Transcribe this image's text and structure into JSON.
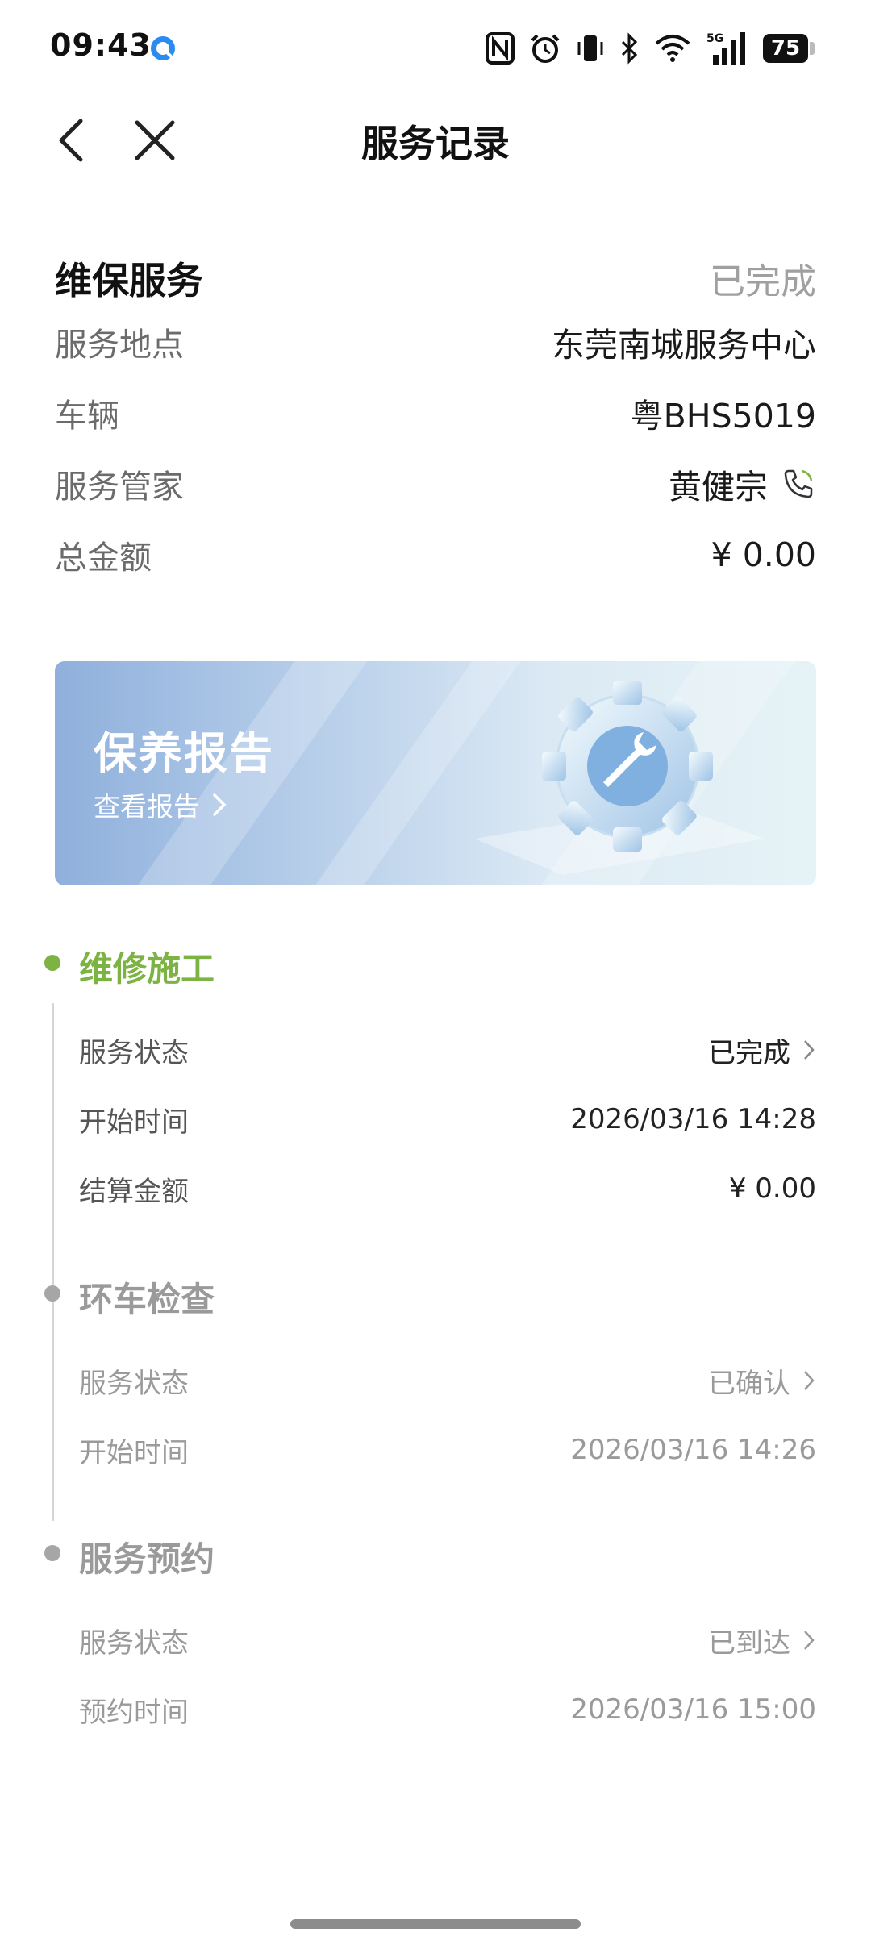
{
  "status_bar": {
    "time": "09:43",
    "icons": [
      "nfc-icon",
      "alarm-icon",
      "vibrate-icon",
      "bluetooth-icon",
      "wifi-icon",
      "signal-5g-icon"
    ],
    "network": "5G",
    "battery": "75"
  },
  "nav": {
    "title": "服务记录",
    "back_icon": "back-arrow-icon",
    "close_icon": "close-icon"
  },
  "summary": {
    "title": "维保服务",
    "status": "已完成",
    "rows": [
      {
        "label": "服务地点",
        "value": "东莞南城服务中心"
      },
      {
        "label": "车辆",
        "value": "粤BHS5019"
      },
      {
        "label": "服务管家",
        "value": "黄健宗"
      },
      {
        "label": "总金额",
        "value": "¥ 0.00"
      }
    ]
  },
  "banner": {
    "title": "保养报告",
    "link": "查看报告",
    "colors": {
      "start": "#8fb0dc",
      "end": "#e6f3f6"
    }
  },
  "timeline": [
    {
      "title": "维修施工",
      "active": true,
      "rows": [
        {
          "label": "服务状态",
          "value": "已完成",
          "link": true
        },
        {
          "label": "开始时间",
          "value": "2026/03/16 14:28",
          "link": false
        },
        {
          "label": "结算金额",
          "value": "¥  0.00",
          "link": false
        }
      ]
    },
    {
      "title": "环车检查",
      "active": false,
      "rows": [
        {
          "label": "服务状态",
          "value": "已确认",
          "link": true
        },
        {
          "label": "开始时间",
          "value": "2026/03/16 14:26",
          "link": false
        }
      ]
    },
    {
      "title": "服务预约",
      "active": false,
      "rows": [
        {
          "label": "服务状态",
          "value": "已到达",
          "link": true
        },
        {
          "label": "预约时间",
          "value": "2026/03/16 15:00",
          "link": false
        }
      ]
    }
  ],
  "colors": {
    "accent": "#7cb342",
    "inactive": "#9a9a9a"
  }
}
